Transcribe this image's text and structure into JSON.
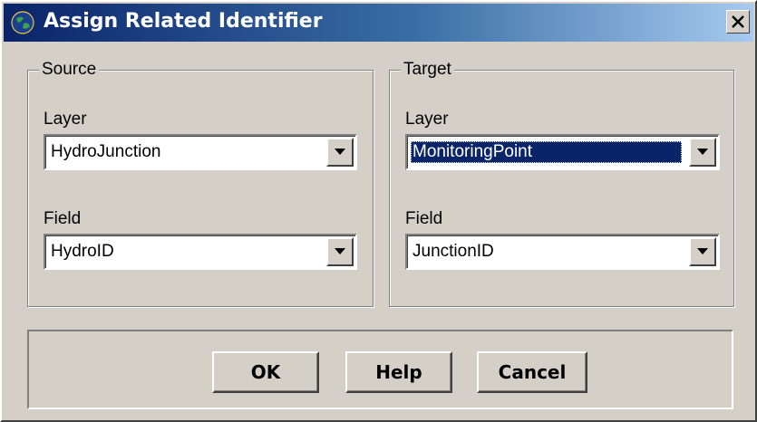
{
  "window": {
    "title": "Assign Related Identifier",
    "close_icon": "close-icon"
  },
  "source": {
    "group_label": "Source",
    "layer_label": "Layer",
    "layer_value": "HydroJunction",
    "field_label": "Field",
    "field_value": "HydroID"
  },
  "target": {
    "group_label": "Target",
    "layer_label": "Layer",
    "layer_value": "MonitoringPoint",
    "field_label": "Field",
    "field_value": "JunctionID"
  },
  "buttons": {
    "ok": "OK",
    "help": "Help",
    "cancel": "Cancel"
  },
  "colors": {
    "dialog_face": "#d4d0c8",
    "titlebar_start": "#0a246a",
    "titlebar_end": "#a6caf0",
    "selection": "#0a246a"
  }
}
